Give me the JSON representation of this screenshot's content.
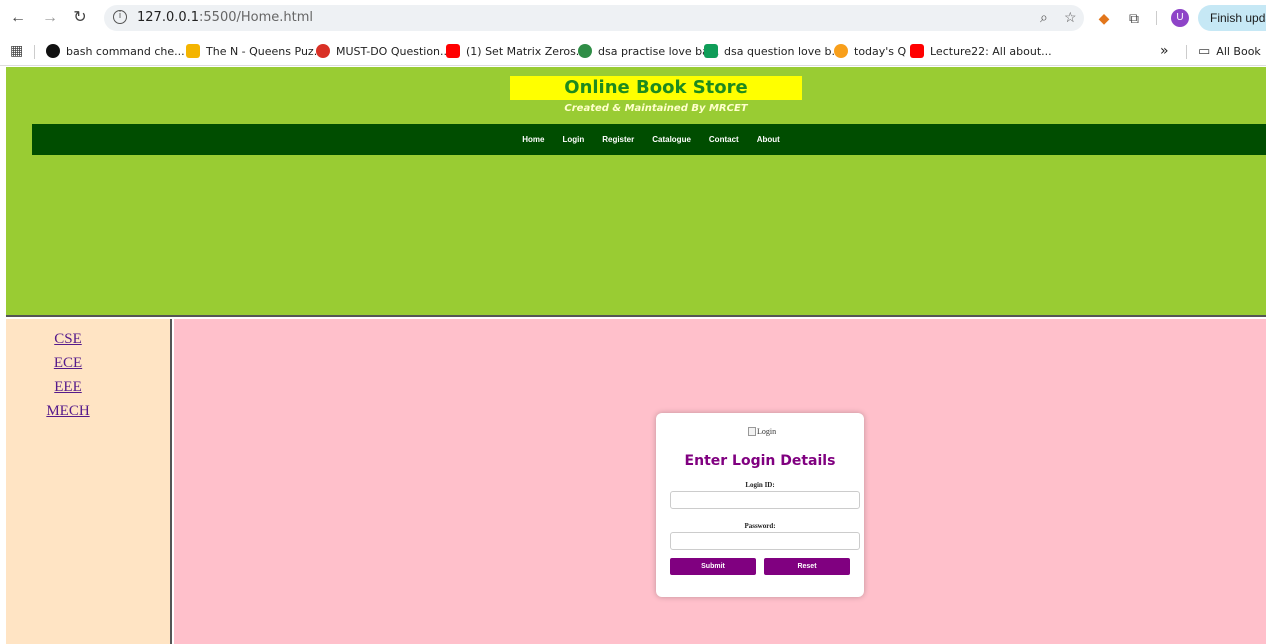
{
  "browser": {
    "url_host": "127.0.0.1",
    "url_rest": ":5500/Home.html",
    "profile_initial": "U",
    "update_label": "Finish upda",
    "bookmarks": [
      {
        "label": "bash command che...",
        "icon": "github-icon",
        "color": "#111111"
      },
      {
        "label": "The N - Queens Puz...",
        "icon": "coding-site-icon",
        "color": "#f4b400"
      },
      {
        "label": "MUST-DO Question...",
        "icon": "tuf-icon",
        "color": "#d93025"
      },
      {
        "label": "(1) Set Matrix Zeros...",
        "icon": "youtube-icon",
        "color": "#ff0000"
      },
      {
        "label": "dsa practise love ba...",
        "icon": "gfg-icon",
        "color": "#2f8d46"
      },
      {
        "label": "dsa question love b...",
        "icon": "sheets-icon",
        "color": "#0f9d58"
      },
      {
        "label": "today's Q",
        "icon": "leetcode-icon",
        "color": "#f89f1b"
      },
      {
        "label": "Lecture22: All about...",
        "icon": "youtube-icon",
        "color": "#ff0000"
      }
    ],
    "overflow": "»",
    "all_bookmarks": "All Book"
  },
  "header": {
    "title": "Online Book Store",
    "subtitle": "Created & Maintained By MRCET",
    "menu": [
      "Home",
      "Login",
      "Register",
      "Catalogue",
      "Contact",
      "About"
    ]
  },
  "sidebar": {
    "links": [
      "CSE",
      "ECE",
      "EEE",
      "MECH"
    ]
  },
  "login": {
    "img_alt": "Login",
    "title": "Enter Login Details",
    "id_label": "Login ID:",
    "id_value": "",
    "password_label": "Password:",
    "password_value": "",
    "submit_label": "Submit",
    "reset_label": "Reset"
  },
  "colors": {
    "header_bg": "#99cc33",
    "title_bg": "#ffff00",
    "title_text": "#1e8a1e",
    "menu_bg": "#004d00",
    "sidebar_bg": "#ffe4c4",
    "content_bg": "#ffc0cb",
    "button_bg": "#800080",
    "login_title": "#800080"
  }
}
